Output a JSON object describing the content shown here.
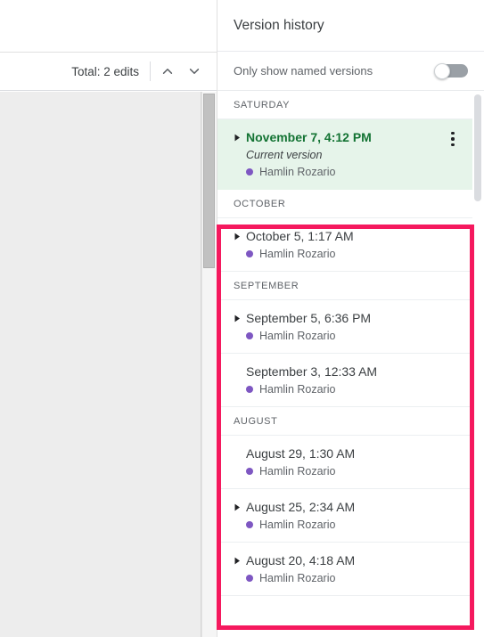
{
  "document_area": {
    "edit_summary": "Total: 2 edits",
    "prev_label": "previous-edit",
    "next_label": "next-edit"
  },
  "panel": {
    "title": "Version history",
    "named_versions_toggle": {
      "label": "Only show named versions",
      "state": "off"
    },
    "author_dot_color": "#7e57c2",
    "current_version_color": "#137333",
    "current_version_background": "#e6f4ea",
    "annotation_color": "#f5195e",
    "groups": [
      {
        "heading": "SATURDAY",
        "versions": [
          {
            "date": "November 7, 4:12 PM",
            "subtitle": "Current version",
            "author": "Hamlin Rozario",
            "expandable": true,
            "current": true,
            "has_menu": true
          }
        ]
      },
      {
        "heading": "OCTOBER",
        "versions": [
          {
            "date": "October 5, 1:17 AM",
            "subtitle": "",
            "author": "Hamlin Rozario",
            "expandable": true,
            "current": false,
            "has_menu": false
          }
        ]
      },
      {
        "heading": "SEPTEMBER",
        "versions": [
          {
            "date": "September 5, 6:36 PM",
            "subtitle": "",
            "author": "Hamlin Rozario",
            "expandable": true,
            "current": false,
            "has_menu": false
          },
          {
            "date": "September 3, 12:33 AM",
            "subtitle": "",
            "author": "Hamlin Rozario",
            "expandable": false,
            "current": false,
            "has_menu": false
          }
        ]
      },
      {
        "heading": "AUGUST",
        "versions": [
          {
            "date": "August 29, 1:30 AM",
            "subtitle": "",
            "author": "Hamlin Rozario",
            "expandable": false,
            "current": false,
            "has_menu": false
          },
          {
            "date": "August 25, 2:34 AM",
            "subtitle": "",
            "author": "Hamlin Rozario",
            "expandable": true,
            "current": false,
            "has_menu": false
          },
          {
            "date": "August 20, 4:18 AM",
            "subtitle": "",
            "author": "Hamlin Rozario",
            "expandable": true,
            "current": false,
            "has_menu": false
          }
        ]
      }
    ]
  }
}
